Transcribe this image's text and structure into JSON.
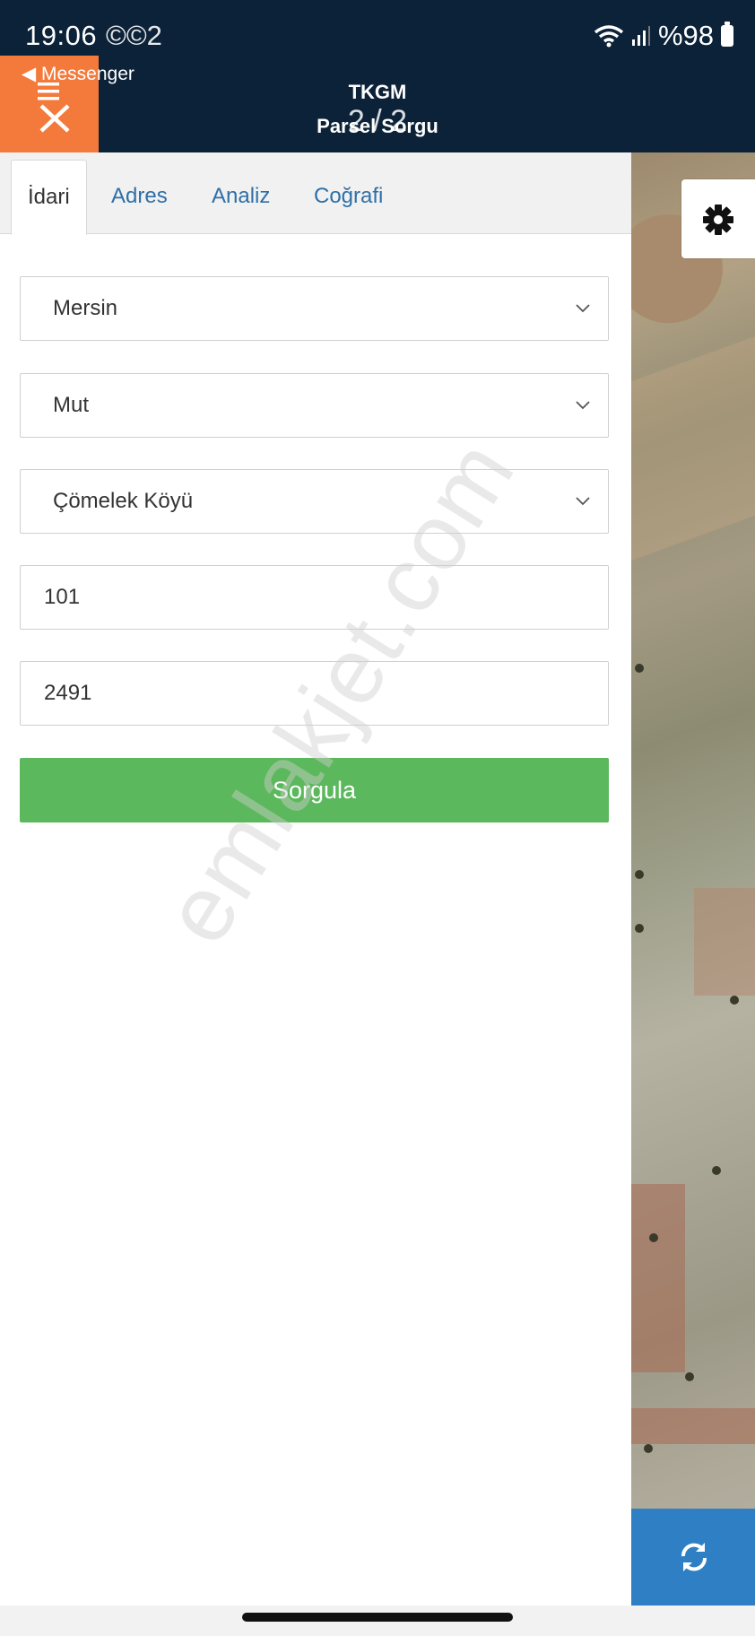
{
  "status_bar": {
    "time": "19:06",
    "ghost_text": "©©2",
    "battery": "%98"
  },
  "header": {
    "back_label": "◀ Messenger",
    "title": "TKGM",
    "subtitle": "Parsel Sorgu",
    "counter": "2 / 2"
  },
  "tabs": [
    {
      "label": "İdari",
      "active": true
    },
    {
      "label": "Adres",
      "active": false
    },
    {
      "label": "Analiz",
      "active": false
    },
    {
      "label": "Coğrafi",
      "active": false
    }
  ],
  "form": {
    "province": "Mersin",
    "district": "Mut",
    "neighborhood": "Çömelek Köyü",
    "block": "101",
    "parcel": "2491",
    "query_button": "Sorgula"
  },
  "watermark": "emlakjet.com",
  "icons": {
    "menu": "menu-close-icon",
    "settings": "gear-icon",
    "refresh": "refresh-icon",
    "wifi": "wifi-icon",
    "signal": "signal-icon",
    "battery": "battery-icon",
    "dropdown": "chevron-down-icon"
  },
  "colors": {
    "header_bg": "#0c2238",
    "menu_bg": "#f47a3c",
    "query_button_bg": "#5cb85c",
    "refresh_bg": "#2f7fc4",
    "tab_link": "#2f6fa7"
  }
}
